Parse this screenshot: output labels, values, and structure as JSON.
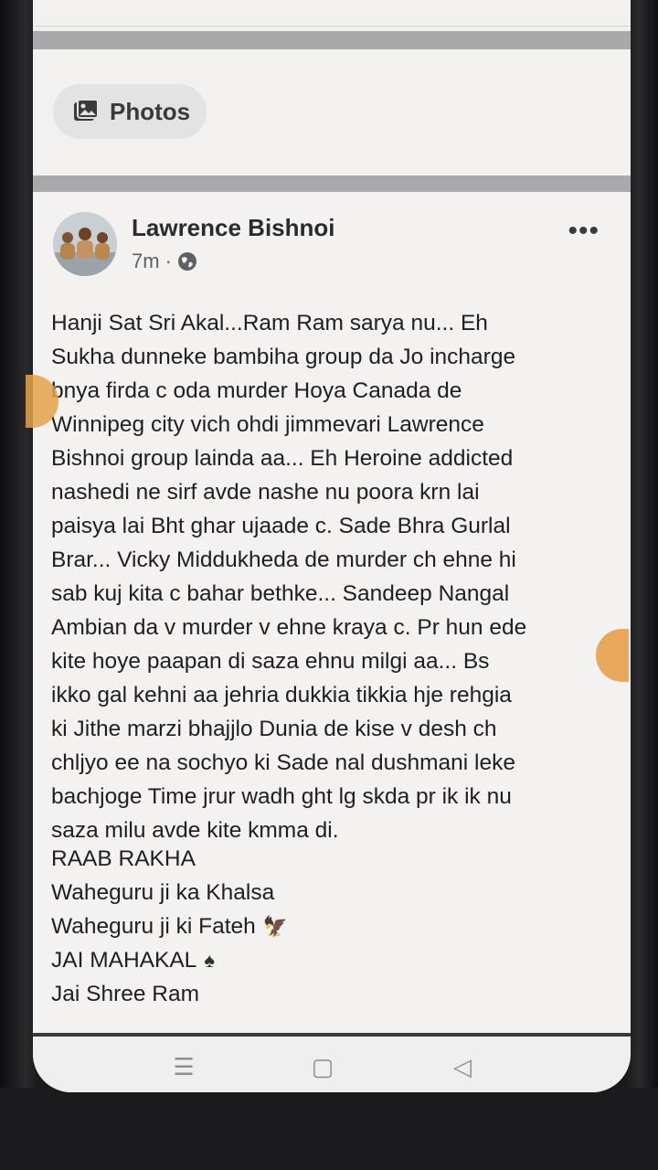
{
  "photos": {
    "label": "Photos",
    "icon": "photos-icon"
  },
  "post": {
    "author": "Lawrence Bishnoi",
    "time": "7m",
    "separator": "·",
    "privacy_icon": "globe-icon",
    "more_icon": "more-options-icon",
    "more_label": "•••",
    "body": "Hanji Sat Sri Akal...Ram Ram sarya nu... Eh\nSukha dunneke bambiha group da Jo incharge\nbnya firda c oda murder Hoya Canada de\nWinnipeg city vich ohdi jimmevari Lawrence\nBishnoi group lainda aa... Eh Heroine addicted\nnashedi ne sirf avde nashe nu poora krn lai\npaisya lai Bht ghar ujaade c. Sade Bhra Gurlal\nBrar... Vicky Middukheda de murder ch ehne hi\nsab kuj kita c bahar bethke... Sandeep Nangal\nAmbian da v murder v ehne kraya c. Pr hun ede\nkite hoye paapan di saza ehnu milgi aa...  Bs\nikko gal kehni aa jehria dukkia tikkia hje rehgia\nki Jithe marzi bhajjlo Dunia de kise v desh ch\nchljyo ee na sochyo ki Sade nal dushmani leke\nbachjoge Time jrur wadh ght lg skda pr ik ik nu\nsaza milu avde kite kmma di.",
    "closing": [
      {
        "text": "RAAB RAKHA",
        "emoji": ""
      },
      {
        "text": "Waheguru ji ka Khalsa",
        "emoji": ""
      },
      {
        "text": "Waheguru ji ki Fateh",
        "emoji": "🦅"
      },
      {
        "text": "JAI MAHAKAL",
        "emoji": "♠"
      },
      {
        "text": "Jai Shree Ram",
        "emoji": ""
      }
    ]
  },
  "nav": {
    "menu": "☰",
    "home": "▢",
    "back": "◁"
  }
}
